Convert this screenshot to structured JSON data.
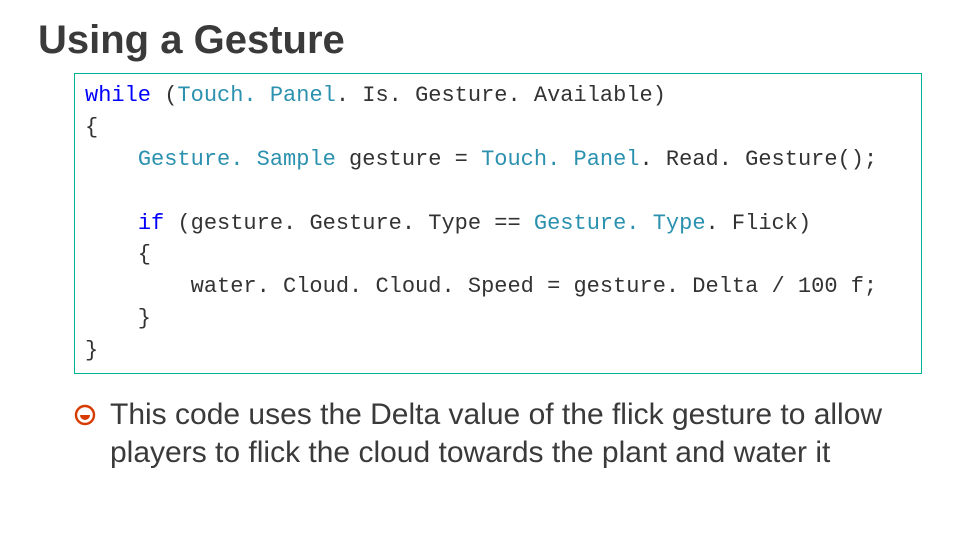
{
  "title": "Using a Gesture",
  "code": {
    "l1a": "while",
    "l1b": " (",
    "l1c": "Touch. Panel",
    "l1d": ". Is. Gesture. Available)",
    "l2": "{",
    "l3a": "    ",
    "l3b": "Gesture. Sample ",
    "l3c": "gesture = ",
    "l3d": "Touch. Panel",
    "l3e": ". Read. Gesture();",
    "l5a": "    ",
    "l5b": "if",
    "l5c": " (gesture. Gesture. Type == ",
    "l5d": "Gesture. Type",
    "l5e": ". Flick)",
    "l6": "    {",
    "l7": "        water. Cloud. Cloud. Speed = gesture. Delta / 100 f;",
    "l8": "    }",
    "l9": "}"
  },
  "bullet_text": "This code uses the Delta value of the flick gesture to allow players to flick the cloud towards the plant and water it"
}
